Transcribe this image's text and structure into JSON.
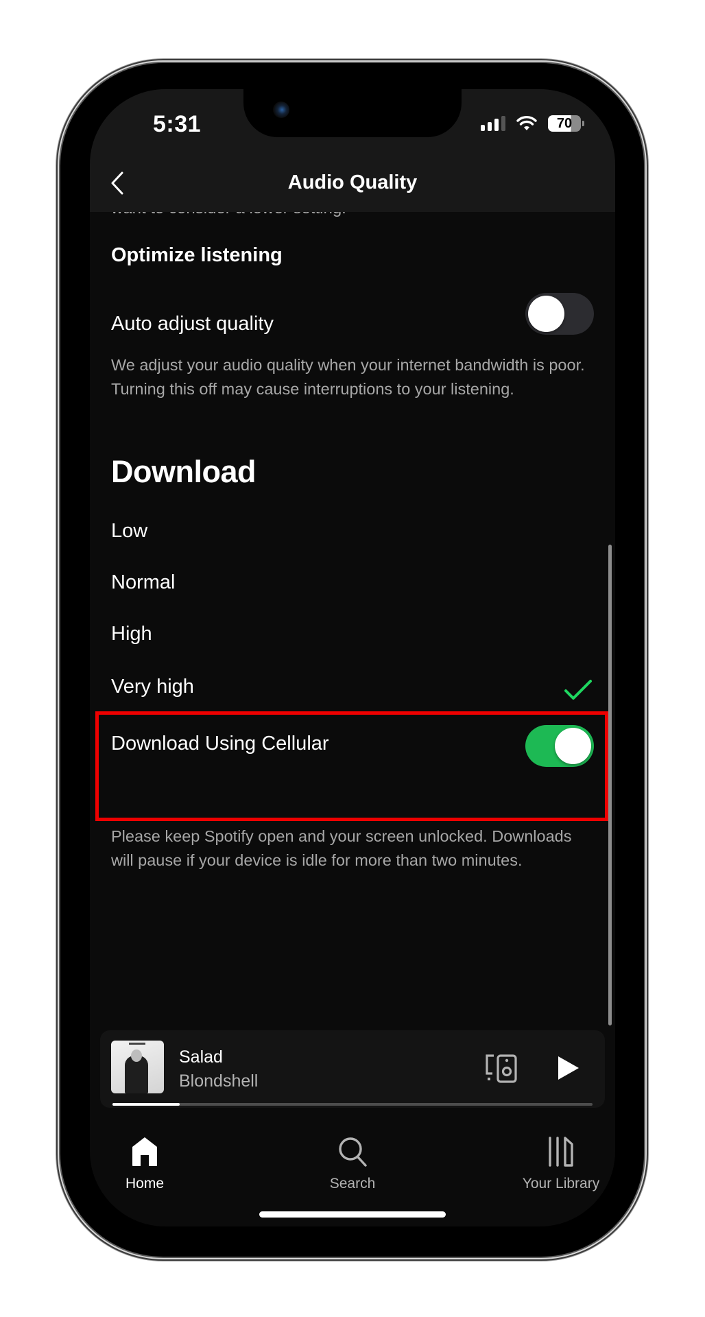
{
  "status_bar": {
    "time": "5:31",
    "battery_percent": "70",
    "battery_level": 0.7,
    "signal_bars_active": 3,
    "signal_bars_total": 4
  },
  "header": {
    "title": "Audio Quality",
    "back_icon": "chevron-left-icon"
  },
  "content": {
    "clipped_text": "want to consider a lower setting.",
    "optimize_section": {
      "heading": "Optimize listening",
      "auto_adjust": {
        "label": "Auto adjust quality",
        "enabled": false,
        "description": "We adjust your audio quality when your internet bandwidth is poor. Turning this off may cause interruptions to your listening."
      }
    },
    "download_section": {
      "heading": "Download",
      "options": [
        {
          "label": "Low",
          "selected": false
        },
        {
          "label": "Normal",
          "selected": false
        },
        {
          "label": "High",
          "selected": false
        },
        {
          "label": "Very high",
          "selected": true
        }
      ],
      "cellular": {
        "label": "Download Using Cellular",
        "enabled": true,
        "description": "Please keep Spotify open and your screen unlocked. Downloads will pause if your device is idle for more than two minutes."
      }
    }
  },
  "mini_player": {
    "title": "Salad",
    "artist": "Blondshell",
    "progress": 0.14,
    "connect_icon": "connect-device-icon",
    "play_icon": "play-icon"
  },
  "tabbar": {
    "tabs": [
      {
        "label": "Home",
        "icon": "home-icon",
        "active": true
      },
      {
        "label": "Search",
        "icon": "search-icon",
        "active": false
      },
      {
        "label": "Your Library",
        "icon": "library-icon",
        "active": false
      }
    ]
  },
  "colors": {
    "accent_green": "#1db954",
    "highlight_red": "#ee0000",
    "background": "#0b0b0b",
    "header_bg": "#181818",
    "secondary_text": "#a7a7a7"
  }
}
